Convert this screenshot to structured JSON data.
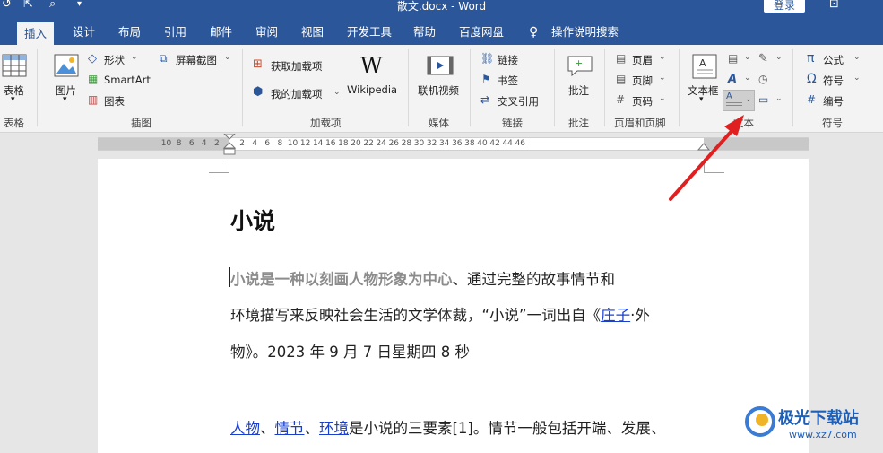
{
  "window": {
    "title": "散文.docx  -  Word",
    "login_label": "登录"
  },
  "tabs": [
    "插入",
    "设计",
    "布局",
    "引用",
    "邮件",
    "审阅",
    "视图",
    "开发工具",
    "帮助",
    "百度网盘"
  ],
  "search_label": "操作说明搜索",
  "ribbon": {
    "table": {
      "label": "表格",
      "group": "表格"
    },
    "illustrations": {
      "picture": "图片",
      "shapes": "形状",
      "smartart": "SmartArt",
      "chart": "图表",
      "screenshot": "屏幕截图",
      "group": "插图"
    },
    "addins": {
      "get": "获取加载项",
      "my": "我的加载项",
      "wikipedia": "Wikipedia",
      "group": "加载项"
    },
    "media": {
      "video": "联机视频",
      "group": "媒体"
    },
    "links": {
      "link": "链接",
      "bookmark": "书签",
      "crossref": "交叉引用",
      "group": "链接"
    },
    "comments": {
      "comment": "批注",
      "group": "批注"
    },
    "headerfooter": {
      "header": "页眉",
      "footer": "页脚",
      "pagenum": "页码",
      "group": "页眉和页脚"
    },
    "text": {
      "textbox": "文本框",
      "group": "文本"
    },
    "symbols": {
      "equation": "公式",
      "symbol": "符号",
      "number": "编号",
      "group": "符号"
    }
  },
  "ruler": {
    "ticks": [
      "10",
      "8",
      "6",
      "4",
      "2",
      "2",
      "4",
      "6",
      "8",
      "10",
      "12",
      "14",
      "16",
      "18",
      "20",
      "22",
      "24",
      "26",
      "28",
      "30",
      "32",
      "34",
      "36",
      "38",
      "40",
      "42",
      "44",
      "46"
    ]
  },
  "document": {
    "heading": "小说",
    "p1_line1_bold": "小说是一种以刻画人物形象为中心",
    "p1_line1_rest": "、通过完整的故事情节和",
    "p1_line2_a": "环境描写来反映社会生活的文学体裁，“小说”一词出自《",
    "p1_line2_link": "庄子",
    "p1_line2_b": "·外",
    "p1_line3": "物》。2023 年 9 月 7 日星期四 8 秒",
    "p2_link1": "人物",
    "p2_sep1": "、",
    "p2_link2": "情节",
    "p2_sep2": "、",
    "p2_link3": "环境",
    "p2_rest": "是小说的三要素[1]。情节一般包括开端、发展、"
  },
  "watermark": {
    "name": "极光下载站",
    "url": "www.xz7.com"
  }
}
